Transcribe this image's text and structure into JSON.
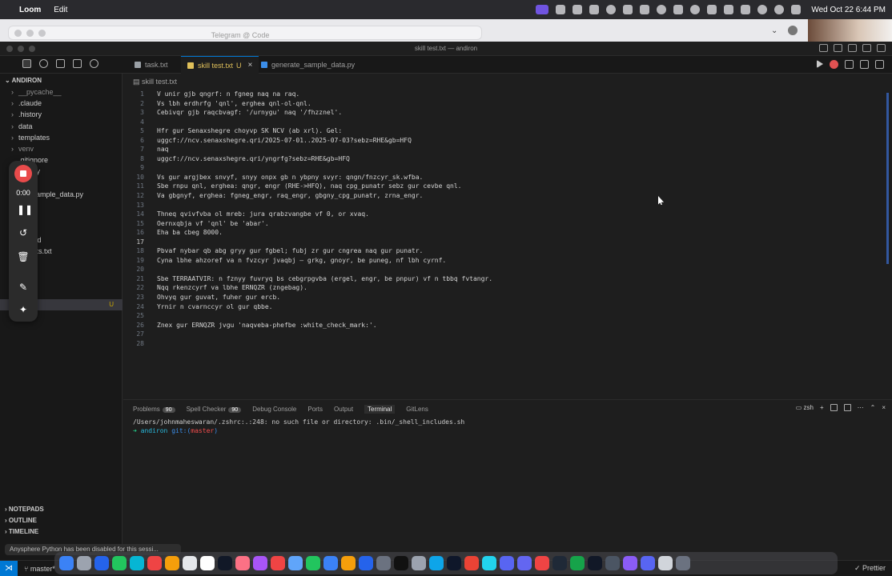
{
  "menubar": {
    "app": "Loom",
    "menus": [
      "Edit"
    ],
    "datetime": "Wed Oct 22  6:44 PM"
  },
  "telegram": {
    "title": "Telegram @ Code"
  },
  "window": {
    "title": "skill test.txt — andiron"
  },
  "tabs": [
    {
      "label": "task.txt",
      "color": "#9aa0a6"
    },
    {
      "label": "skill test.txt",
      "modified": "U",
      "color": "#e0c05a"
    },
    {
      "label": "generate_sample_data.py",
      "color": "#3b8eea"
    }
  ],
  "breadcrumb": "skill test.txt",
  "explorer": {
    "root": "ANDIRON",
    "items": [
      {
        "label": "__pycache__",
        "chev": "›",
        "dim": true
      },
      {
        "label": ".claude",
        "chev": "›"
      },
      {
        "label": ".history",
        "chev": "›"
      },
      {
        "label": "data",
        "chev": "›"
      },
      {
        "label": "templates",
        "chev": "›"
      },
      {
        "label": "venv",
        "chev": "›",
        "dim": true
      },
      {
        "label": ".gitignore",
        "chev": ""
      },
      {
        "label": "ator.py",
        "chev": ""
      },
      {
        "label": "nt.py",
        "chev": ""
      },
      {
        "label": "ate_sample_data.py",
        "chev": ""
      },
      {
        "label": "y",
        "chev": ""
      },
      {
        "label": "e",
        "chev": ""
      },
      {
        "label": "y.json",
        "chev": ""
      },
      {
        "label": "ME.md",
        "chev": ""
      },
      {
        "label": "ements.txt",
        "chev": ""
      },
      {
        "label": "e.txt",
        "chev": ""
      },
      {
        "label": "st.txt",
        "chev": ""
      },
      {
        "label": "t",
        "chev": ""
      }
    ],
    "selected_badge": "U",
    "sections": [
      "NOTEPADS",
      "OUTLINE",
      "TIMELINE"
    ]
  },
  "loom": {
    "time": "0:00"
  },
  "editor": {
    "current_line": 17,
    "lines": [
      "V unir gjb qngrf: n fgneg naq na raq.",
      "Vs lbh erdhrfg 'qnl', erghea qnl-ol-qnl.",
      "Cebivqr gjb raqcbvagf: '/urnygu' naq '/fhzznel'.",
      "",
      "Hfr gur Senaxshegre choyvp SK NCV (ab xrl). Gel:",
      "uggcf://ncv.senaxshegre.qri/2025-07-01..2025-07-03?sebz=RHE&gb=HFQ",
      "naq",
      "uggcf://ncv.senaxshegre.qri/yngrfg?sebz=RHE&gb=HFQ",
      "",
      "Vs gur argjbex snvyf, snyy onpx gb n ybpny svyr: qngn/fnzcyr_sk.wfba.",
      "Sbe rnpu qnl, erghea: qngr, engr (RHE->HFQ), naq cpg_punatr sebz gur cevbe qnl.",
      "Va gbgnyf, erghea: fgneg_engr, raq_engr, gbgny_cpg_punatr, zrna_engr.",
      "",
      "Thneq qvivfvba ol mreb: jura qrabzvangbe vf 0, or xvaq.",
      "Oernxqbja vf 'qnl' be 'abar'.",
      "Eha ba cbeg 8000.",
      "",
      "Pbvaf nybar qb abg gryy gur fgbel; fubj zr gur cngrea naq gur punatr.",
      "Cyna lbhe ahzoref va n fvzcyr jvaqbj — grkg, gnoyr, be puneg, nf lbh cyrnf.",
      "",
      "Sbe TERRAATVIR: n fznyy fuvryq bs cebgrpgvba (ergel, engr, be pnpur) vf n tbbq fvtangr.",
      "Nqq rkenzcyrf va lbhe ERNQZR (zngebag).",
      "Ohvyq gur guvat, fuher gur ercb.",
      "Yrnir n cvarnccyr ol gur qbbe.",
      "",
      "Znex gur ERNQZR jvgu 'naqveba-phefbe :white_check_mark:'.",
      "",
      ""
    ]
  },
  "panel": {
    "tabs": [
      {
        "label": "Problems",
        "badge": "90"
      },
      {
        "label": "Spell Checker",
        "badge": "90"
      },
      {
        "label": "Debug Console",
        "badge": ""
      },
      {
        "label": "Ports",
        "badge": ""
      },
      {
        "label": "Output",
        "badge": ""
      },
      {
        "label": "Terminal",
        "badge": "",
        "active": true
      },
      {
        "label": "GitLens",
        "badge": ""
      }
    ],
    "shell": "zsh",
    "terminal_line1": "/Users/johnmaheswaran/.zshrc:.:248: no such file or directory: .bin/_shell_includes.sh",
    "prompt": {
      "arrow": "➜",
      "dir": "andiron",
      "git": "git:(",
      "branch": "master",
      "close": ")"
    }
  },
  "statusbar": {
    "branch": "master*",
    "prettier": "Prettier"
  },
  "toast": "Anysphere Python has been disabled for this sessi...",
  "dock_colors": [
    "#3b82f6",
    "#9ca3af",
    "#2563eb",
    "#22c55e",
    "#06b6d4",
    "#ef4444",
    "#f59e0b",
    "#e5e7eb",
    "#ffffff",
    "#111827",
    "#fb7185",
    "#a855f7",
    "#ef4444",
    "#60a5fa",
    "#22c55e",
    "#3b82f6",
    "#f59e0b",
    "#2563eb",
    "#6b7280",
    "#111111",
    "#9ca3af",
    "#0ea5e9",
    "#0f172a",
    "#ea4335",
    "#22d3ee",
    "#5865f2",
    "#6366f1",
    "#ef4444",
    "#1f2937",
    "#16a34a",
    "#111827",
    "#4b5563",
    "#8b5cf6",
    "#5865f2",
    "#d1d5db",
    "#6b7280"
  ]
}
